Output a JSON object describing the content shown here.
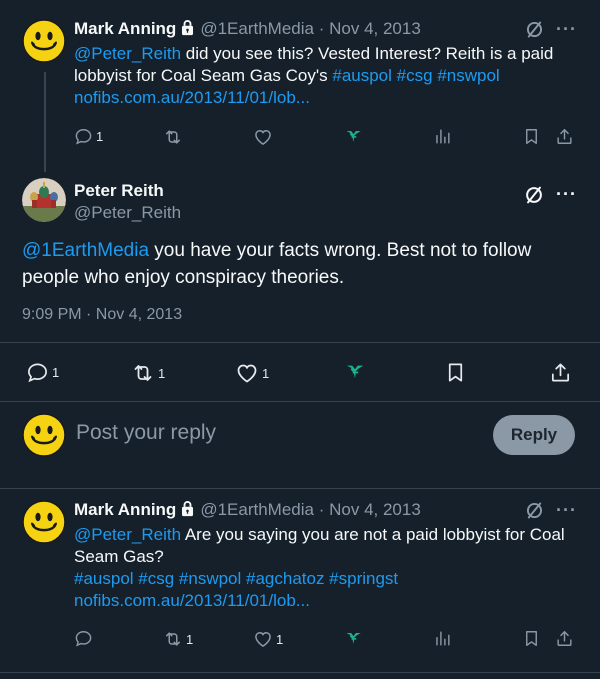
{
  "colors": {
    "background": "#15202b",
    "link": "#1d9bf0",
    "muted": "#8b98a5",
    "grok": "#19b38d",
    "smiley": "#f5d312"
  },
  "tweet1": {
    "name": "Mark Anning",
    "handle": "@1EarthMedia",
    "dot": "·",
    "date": "Nov 4, 2013",
    "mention": "@Peter_Reith",
    "text1": " did you see this? Vested Interest? Reith is a paid lobbyist for Coal Seam Gas Coy's ",
    "tag1": "#auspol",
    "tag2": "#csg",
    "tag3": "#nswpol",
    "url": "nofibs.com.au/2013/11/01/lob...",
    "reply_count": "1"
  },
  "tweet2": {
    "name": "Peter Reith",
    "handle": "@Peter_Reith",
    "mention": "@1EarthMedia",
    "text": " you have your facts wrong. Best not to follow people who enjoy conspiracy theories.",
    "timestamp": "9:09 PM · Nov 4, 2013",
    "reply_count": "1",
    "retweet_count": "1",
    "like_count": "1"
  },
  "reply_box": {
    "placeholder": "Post your reply",
    "button": "Reply"
  },
  "tweet3": {
    "name": "Mark Anning",
    "handle": "@1EarthMedia",
    "dot": "·",
    "date": "Nov 4, 2013",
    "mention": "@Peter_Reith",
    "text1": " Are you saying you are not a paid lobbyist for Coal Seam Gas?",
    "hashtags": "#auspol #csg #nswpol #agchatoz #springst",
    "url": "nofibs.com.au/2013/11/01/lob...",
    "retweet_count": "1",
    "like_count": "1"
  }
}
